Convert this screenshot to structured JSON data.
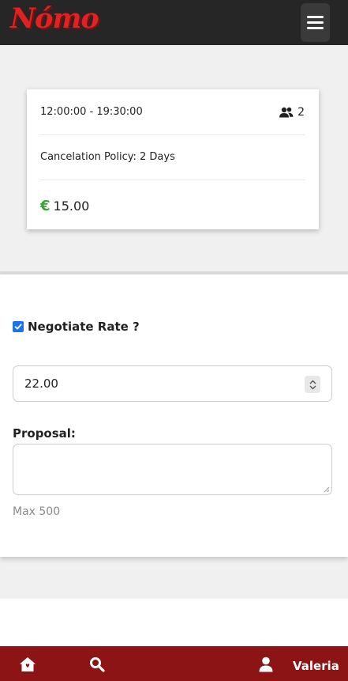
{
  "header": {
    "logo_text": "Nómo",
    "menu_icon": "hamburger-icon"
  },
  "booking": {
    "time_range": "12:00:00 - 19:30:00",
    "guests_icon": "users-icon",
    "guests": "2",
    "cancellation_policy": "Cancelation Policy: 2 Days",
    "currency_symbol": "€",
    "price": "15.00"
  },
  "form": {
    "negotiate_label": "Negotiate Rate ?",
    "negotiate_checked": true,
    "rate_value": "22.00",
    "proposal_label": "Proposal:",
    "proposal_value": "",
    "max_hint": "Max 500"
  },
  "bottom_nav": {
    "home_icon": "home-icon",
    "search_icon": "search-icon",
    "user_icon": "user-icon",
    "user_name": "Valeria"
  },
  "colors": {
    "header_bg": "#262626",
    "logo_red": "#e02222",
    "footer_bg": "#8c1414",
    "euro_green": "#3aa23a",
    "checkbox_blue": "#1a73e8"
  }
}
